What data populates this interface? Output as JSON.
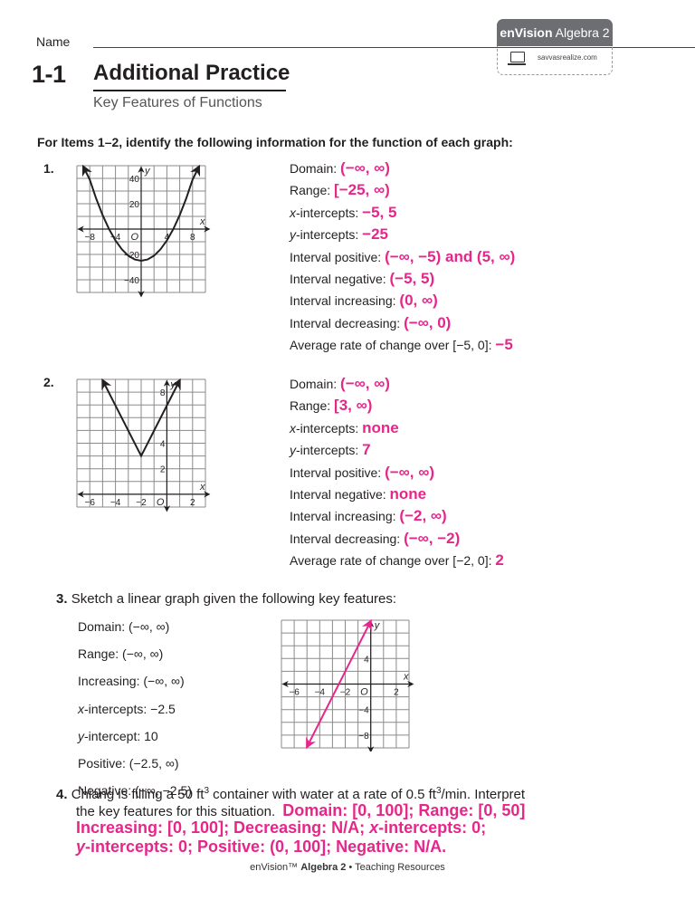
{
  "header": {
    "name_label": "Name",
    "badge_brand": "enVision",
    "badge_product": "Algebra 2",
    "badge_url": "savvasrealize.com",
    "lesson_number": "1-1",
    "title": "Additional Practice",
    "subtitle": "Key Features of Functions"
  },
  "instructions": "For Items 1–2, identify the following information for the function of each graph:",
  "items": [
    {
      "number": "1.",
      "rows": [
        {
          "label": "Domain:",
          "answer": "(−∞, ∞)"
        },
        {
          "label": "Range:",
          "answer": "[−25, ∞)"
        },
        {
          "label_italic": "x",
          "label": "-intercepts:",
          "answer": "−5, 5"
        },
        {
          "label_italic": "y",
          "label": "-intercepts:",
          "answer": "−25"
        },
        {
          "label": "Interval positive:",
          "answer": "(−∞, −5) and (5, ∞)"
        },
        {
          "label": "Interval negative:",
          "answer": "(−5, 5)"
        },
        {
          "label": "Interval increasing:",
          "answer": "(0, ∞)"
        },
        {
          "label": "Interval decreasing:",
          "answer": "(−∞, 0)"
        },
        {
          "label": "Average rate of change over [−5, 0]:",
          "answer": "−5"
        }
      ]
    },
    {
      "number": "2.",
      "rows": [
        {
          "label": "Domain:",
          "answer": "(−∞, ∞)"
        },
        {
          "label": "Range:",
          "answer": "[3, ∞)"
        },
        {
          "label_italic": "x",
          "label": "-intercepts:",
          "answer": "none"
        },
        {
          "label_italic": "y",
          "label": "-intercepts:",
          "answer": "7"
        },
        {
          "label": "Interval positive:",
          "answer": "(−∞, ∞)"
        },
        {
          "label": "Interval negative:",
          "answer": "none"
        },
        {
          "label": "Interval increasing:",
          "answer": "(−2, ∞)"
        },
        {
          "label": "Interval decreasing:",
          "answer": "(−∞, −2)"
        },
        {
          "label": "Average rate of change over [−2, 0]:",
          "answer": "2"
        }
      ]
    }
  ],
  "item3": {
    "number": "3.",
    "prompt": "Sketch a linear graph given the following key features:",
    "features": [
      {
        "label": "Domain: (−∞, ∞)"
      },
      {
        "label": "Range: (−∞, ∞)"
      },
      {
        "label": "Increasing: (−∞, ∞)"
      },
      {
        "label_italic": "x",
        "label": "-intercepts: −2.5"
      },
      {
        "label_italic": "y",
        "label": "-intercept: 10"
      },
      {
        "label": "Positive: (−2.5, ∞)"
      },
      {
        "label": "Negative: (−∞, −2.5)"
      }
    ]
  },
  "item4": {
    "number": "4.",
    "text_a": "Chiang is filling a 50 ft",
    "sup": "3",
    "text_b": " container with water at a rate of 0.5 ft",
    "text_c": "/min. Interpret",
    "text_d": "the key features for this situation.",
    "answer_1": "Domain: [0, 100]; Range: [0, 50]",
    "answer_2a": "Increasing: [0, 100]; Decreasing: N/A; ",
    "answer_2b_italic": "x",
    "answer_2c": "-intercepts: 0;",
    "answer_3a_italic": "y",
    "answer_3b": "-intercepts: 0; Positive: (0, 100]; Negative: N/A."
  },
  "footer": {
    "brand": "enVision™ ",
    "product": "Algebra 2",
    "rest": " • Teaching Resources"
  },
  "colors": {
    "answer": "#e6268b",
    "text": "#231f20",
    "badge": "#6d6e71"
  },
  "chart_data": [
    {
      "type": "line",
      "title": "Item 1 graph",
      "function": "parabola",
      "xlabel": "x",
      "ylabel": "y",
      "xlim": [
        -10,
        10
      ],
      "ylim": [
        -50,
        50
      ],
      "x_ticks": [
        -8,
        -4,
        4,
        8
      ],
      "x_tick_labels": [
        "−8",
        "−4",
        "4",
        "8"
      ],
      "y_ticks": [
        40,
        20,
        -20,
        -40
      ],
      "y_tick_labels": [
        "40",
        "20",
        "−20",
        "−40"
      ],
      "origin_label": "O",
      "grid": true,
      "points": [
        [
          -9,
          56
        ],
        [
          -8,
          39
        ],
        [
          -7,
          24
        ],
        [
          -6,
          11
        ],
        [
          -5,
          0
        ],
        [
          -4,
          -9
        ],
        [
          -3,
          -16
        ],
        [
          -2,
          -21
        ],
        [
          -1,
          -24
        ],
        [
          0,
          -25
        ],
        [
          1,
          -24
        ],
        [
          2,
          -21
        ],
        [
          3,
          -16
        ],
        [
          4,
          -9
        ],
        [
          5,
          0
        ],
        [
          6,
          11
        ],
        [
          7,
          24
        ],
        [
          8,
          39
        ],
        [
          9,
          56
        ]
      ],
      "color": "#231f20"
    },
    {
      "type": "line",
      "title": "Item 2 graph",
      "function": "absolute value",
      "xlabel": "x",
      "ylabel": "y",
      "xlim": [
        -7,
        3
      ],
      "ylim": [
        -1,
        9
      ],
      "x_ticks": [
        -6,
        -4,
        -2,
        2
      ],
      "x_tick_labels": [
        "−6",
        "−4",
        "−2",
        "2"
      ],
      "y_ticks": [
        8,
        4,
        2
      ],
      "y_tick_labels": [
        "8",
        "4",
        "2"
      ],
      "origin_label": "O",
      "grid": true,
      "points": [
        [
          -5,
          9
        ],
        [
          -2,
          3
        ],
        [
          1,
          9
        ]
      ],
      "color": "#231f20"
    },
    {
      "type": "line",
      "title": "Item 3 graph",
      "function": "linear",
      "xlabel": "x",
      "ylabel": "y",
      "xlim": [
        -7,
        3
      ],
      "ylim": [
        -10,
        10
      ],
      "x_ticks": [
        -6,
        -4,
        -2,
        2
      ],
      "x_tick_labels": [
        "−6",
        "−4",
        "−2",
        "2"
      ],
      "y_ticks": [
        4,
        -4,
        -8
      ],
      "y_tick_labels": [
        "4",
        "−4",
        "−8"
      ],
      "origin_label": "O",
      "grid": true,
      "points": [
        [
          -5,
          -10
        ],
        [
          0,
          10
        ]
      ],
      "color": "#e6268b"
    }
  ]
}
